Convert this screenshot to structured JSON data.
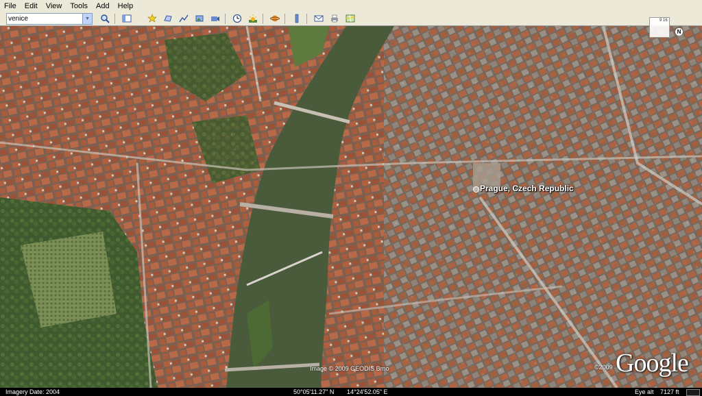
{
  "menu": [
    "File",
    "Edit",
    "View",
    "Tools",
    "Add",
    "Help"
  ],
  "search": {
    "value": "venice"
  },
  "toolbar": {
    "icons": [
      "search-icon",
      "sidebar-toggle-icon",
      "placemark-icon",
      "polygon-icon",
      "path-icon",
      "image-overlay-icon",
      "record-tour-icon",
      "historical-imagery-icon",
      "sunlight-icon",
      "planet-icon",
      "ruler-icon",
      "email-icon",
      "print-icon",
      "google-maps-icon"
    ]
  },
  "map": {
    "place_label": "Prague, Czech Republic",
    "image_credit": "Image © 2009 GEODIS Brno",
    "copyright": "©2009",
    "logo": "Google"
  },
  "compass": {
    "value": "9 16",
    "north": "N"
  },
  "status": {
    "imagery_date": "Imagery Date: 2004",
    "latitude": "50°05'11.27\" N",
    "longitude": "14°24'52.05\" E",
    "eye_alt": "Eye alt",
    "eye_alt_value": "7127 ft"
  },
  "colors": {
    "river": "#4a5b3c",
    "roofs": "#a0583a",
    "park": "#4f6b3a",
    "toolbar": "#ece9d8"
  }
}
